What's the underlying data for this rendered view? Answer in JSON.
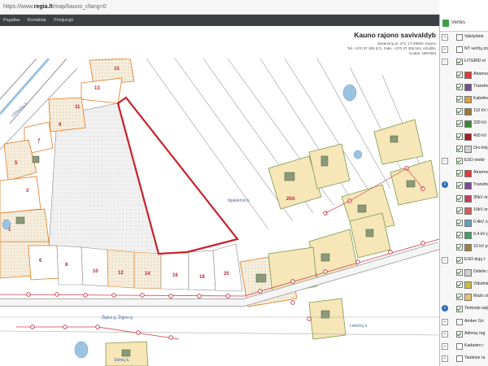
{
  "browser": {
    "url_prefix": "https://www.",
    "url_host": "regia.lt",
    "url_path": "/map/kauno_r/lang=0"
  },
  "nav": {
    "items": [
      "Pagalba",
      "Kontaktai",
      "Prisijungti"
    ]
  },
  "header": {
    "title": "Kauno rajono savivaldyb",
    "lines": [
      "Savanorių pr. 371, LT-49500, Kauno",
      "Tel. +370 37 305 571, Faks. +370 37 305 501, info@kr",
      "Kodas: 1887563"
    ]
  },
  "map": {
    "labels": {
      "road_top": "Užliedžių k.",
      "field": "Ilgakiemio k.",
      "road_main": "Žiglos g. Žiglos g",
      "village": "Lekėčių k.",
      "village2": "Stirnių k.",
      "parcel_20a": "20A"
    },
    "parcels": [
      "15",
      "13",
      "11",
      "9",
      "7",
      "5",
      "3",
      "1",
      "6",
      "8",
      "10",
      "12",
      "14",
      "16",
      "18",
      "20"
    ]
  },
  "panel": {
    "tab_label": "Vertės",
    "layers": [
      {
        "type": "group",
        "expand": "+",
        "checked": false,
        "label": "Valstybinė"
      },
      {
        "type": "group",
        "expand": "+",
        "checked": false,
        "label": "NT verčių zon"
      },
      {
        "type": "group",
        "expand": "−",
        "checked": true,
        "label": "LITGRID el"
      },
      {
        "type": "item",
        "checked": true,
        "swatch": "#e23a3a",
        "label": "Atramos"
      },
      {
        "type": "item",
        "checked": true,
        "swatch": "#7a4a9a",
        "label": "Transform"
      },
      {
        "type": "item",
        "checked": true,
        "swatch": "#d8a040",
        "label": "Kabelinės"
      },
      {
        "type": "item",
        "checked": true,
        "swatch": "#9a7a30",
        "label": "110 kV oro"
      },
      {
        "type": "item",
        "checked": true,
        "swatch": "#3a8a3a",
        "label": "330 kV oro"
      },
      {
        "type": "item",
        "checked": true,
        "swatch": "#a02020",
        "label": "400 kV oro"
      },
      {
        "type": "item",
        "checked": true,
        "swatch": "#d0d0d0",
        "label": "Oro linijų"
      },
      {
        "type": "group",
        "expand": "−",
        "checked": true,
        "label": "ESO elektr"
      },
      {
        "type": "item",
        "checked": true,
        "swatch": "#e23a3a",
        "label": "Atramos"
      },
      {
        "type": "info",
        "checked": true,
        "swatch": "#7a4a9a",
        "label": "Transform"
      },
      {
        "type": "item",
        "checked": true,
        "swatch": "#c04060",
        "label": "35kV oro"
      },
      {
        "type": "item",
        "checked": true,
        "swatch": "#d06060",
        "label": "10kV oro"
      },
      {
        "type": "item",
        "checked": true,
        "swatch": "#60a0c0",
        "label": "0.4kV oro"
      },
      {
        "type": "item",
        "checked": true,
        "swatch": "#40a060",
        "label": "0.4 kV po"
      },
      {
        "type": "item",
        "checked": true,
        "swatch": "#a08040",
        "label": "10 kV pož"
      },
      {
        "type": "group",
        "expand": "−",
        "checked": true,
        "label": "ESO dujų t"
      },
      {
        "type": "item",
        "checked": true,
        "swatch": "#d0d0d0",
        "label": "Didelio sl"
      },
      {
        "type": "item",
        "checked": true,
        "swatch": "#c8c040",
        "label": "Vidutinio"
      },
      {
        "type": "item",
        "checked": true,
        "swatch": "#e6c070",
        "label": "Mažo slė"
      },
      {
        "type": "info2",
        "checked": true,
        "swatch": "",
        "label": "Teritorijo salygonim"
      },
      {
        "type": "group",
        "expand": "+",
        "checked": false,
        "label": "Amber Gri"
      },
      {
        "type": "group",
        "expand": "+",
        "checked": true,
        "label": "Adresų reg"
      },
      {
        "type": "group",
        "expand": "+",
        "checked": false,
        "label": "Kadastro r"
      },
      {
        "type": "group",
        "expand": "+",
        "checked": false,
        "label": "Tautinės ra"
      }
    ]
  }
}
